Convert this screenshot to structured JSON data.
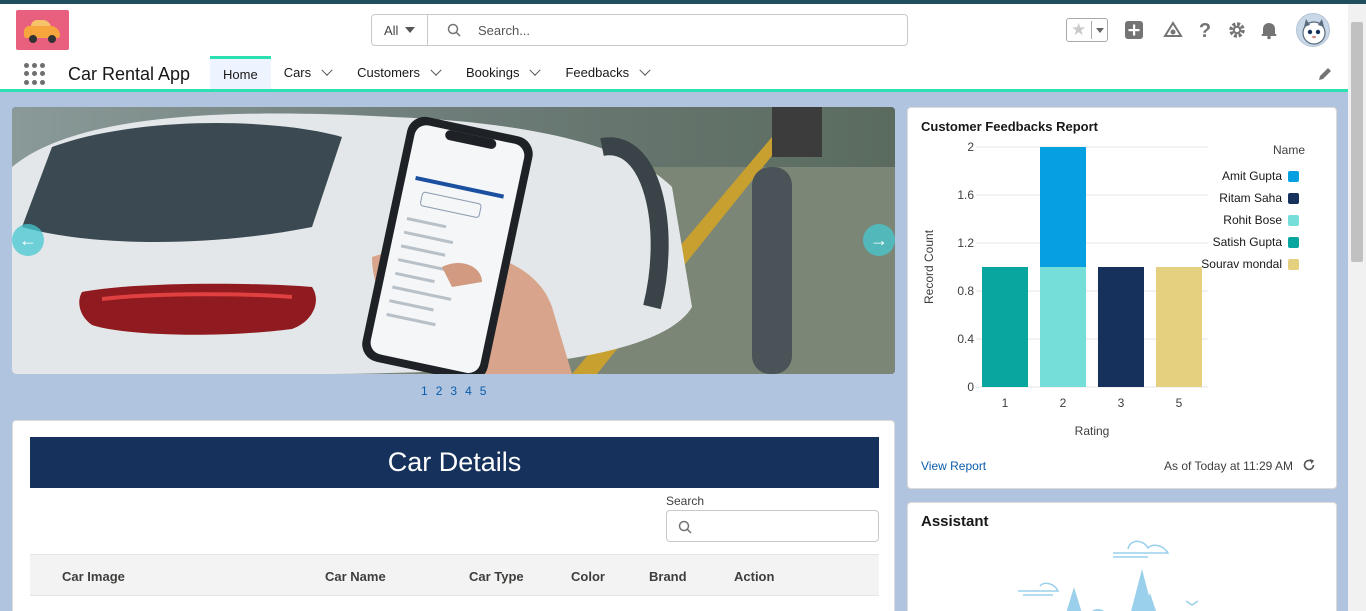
{
  "header": {
    "search_scope": "All",
    "search_placeholder": "Search..."
  },
  "nav": {
    "app_name": "Car Rental App",
    "items": [
      {
        "label": "Home",
        "active": true,
        "has_menu": false
      },
      {
        "label": "Cars",
        "active": false,
        "has_menu": true
      },
      {
        "label": "Customers",
        "active": false,
        "has_menu": true
      },
      {
        "label": "Bookings",
        "active": false,
        "has_menu": true
      },
      {
        "label": "Feedbacks",
        "active": false,
        "has_menu": true
      }
    ]
  },
  "carousel": {
    "pages": [
      "1",
      "2",
      "3",
      "4",
      "5"
    ]
  },
  "car_details": {
    "title": "Car Details",
    "search_label": "Search",
    "columns": [
      "Car Image",
      "Car Name",
      "Car Type",
      "Color",
      "Brand",
      "Action"
    ]
  },
  "feedback_report": {
    "title": "Customer Feedbacks Report",
    "view_report": "View Report",
    "as_of": "As of Today at 11:29 AM"
  },
  "chart_data": {
    "type": "bar",
    "stacked": true,
    "xlabel": "Rating",
    "ylabel": "Record Count",
    "categories": [
      "1",
      "2",
      "3",
      "5"
    ],
    "ylim": [
      0,
      2
    ],
    "yticks": [
      "0",
      "0.4",
      "0.8",
      "1.2",
      "1.6",
      "2"
    ],
    "legend_title": "Name",
    "legend_position": "right",
    "series": [
      {
        "name": "Amit Gupta",
        "color": "#069fe0",
        "values": [
          0,
          1,
          0,
          0
        ]
      },
      {
        "name": "Ritam Saha",
        "color": "#16325c",
        "values": [
          0,
          0,
          1,
          0
        ]
      },
      {
        "name": "Rohit Bose",
        "color": "#76ded9",
        "values": [
          0,
          1,
          0,
          0
        ]
      },
      {
        "name": "Satish Gupta",
        "color": "#08a69e",
        "values": [
          1,
          0,
          0,
          0
        ]
      },
      {
        "name": "Sourav mondal",
        "color": "#e4d07e",
        "values": [
          0,
          0,
          0,
          1
        ]
      }
    ],
    "stack_order": [
      "Satish Gupta",
      "Rohit Bose",
      "Amit Gupta",
      "Ritam Saha",
      "Sourav mondal"
    ]
  },
  "assistant": {
    "title": "Assistant"
  },
  "colors": {
    "accent": "#2ce0b1",
    "brand_navy": "#16325c",
    "link": "#0b5cab"
  }
}
